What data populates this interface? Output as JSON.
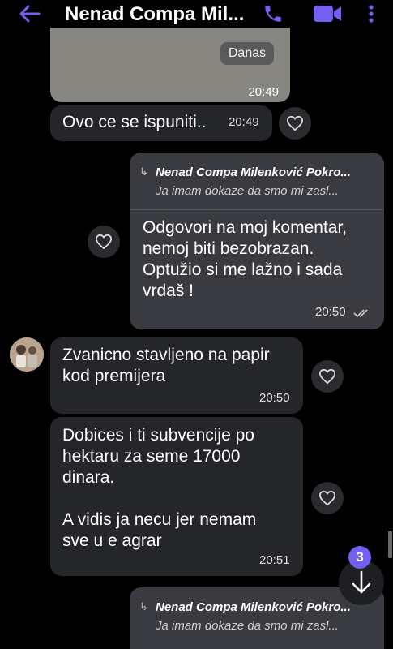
{
  "header": {
    "title": "Nenad Compa Mil...",
    "accent_color": "#7360f2"
  },
  "messages": {
    "image_msg": {
      "date_label": "Danas",
      "time": "20:49"
    },
    "msg1": {
      "text": "Ovo ce se ispuniti..",
      "time": "20:49"
    },
    "msg2": {
      "reply_author": "Nenad Compa Milenković Pokro...",
      "reply_text": "Ja imam dokaze da smo mi zasl...",
      "text": "Odgovori na moj komentar,\nnemoj biti bezobrazan.\nOptužio si me lažno i sada\nvrdaš !",
      "time": "20:50"
    },
    "msg3": {
      "text": "Zvanicno stavljeno na papir\nkod premijera",
      "time": "20:50"
    },
    "msg4": {
      "text": "Dobices i ti subvencije po\nhektaru  za seme 17000\ndinara.\n\nA vidis ja necu jer nemam\nsve u e agrar",
      "time": "20:51"
    },
    "msg5": {
      "reply_author": "Nenad Compa Milenković Pokro...",
      "reply_text": "Ja imam dokaze da smo mi zasl..."
    }
  },
  "scroll_badge": "3",
  "icons": {
    "back": "back-arrow-icon",
    "call": "phone-icon",
    "video": "video-camera-icon",
    "more": "more-vertical-icon",
    "like": "heart-outline-icon",
    "seen": "double-check-icon",
    "scroll_down": "arrow-down-icon"
  }
}
